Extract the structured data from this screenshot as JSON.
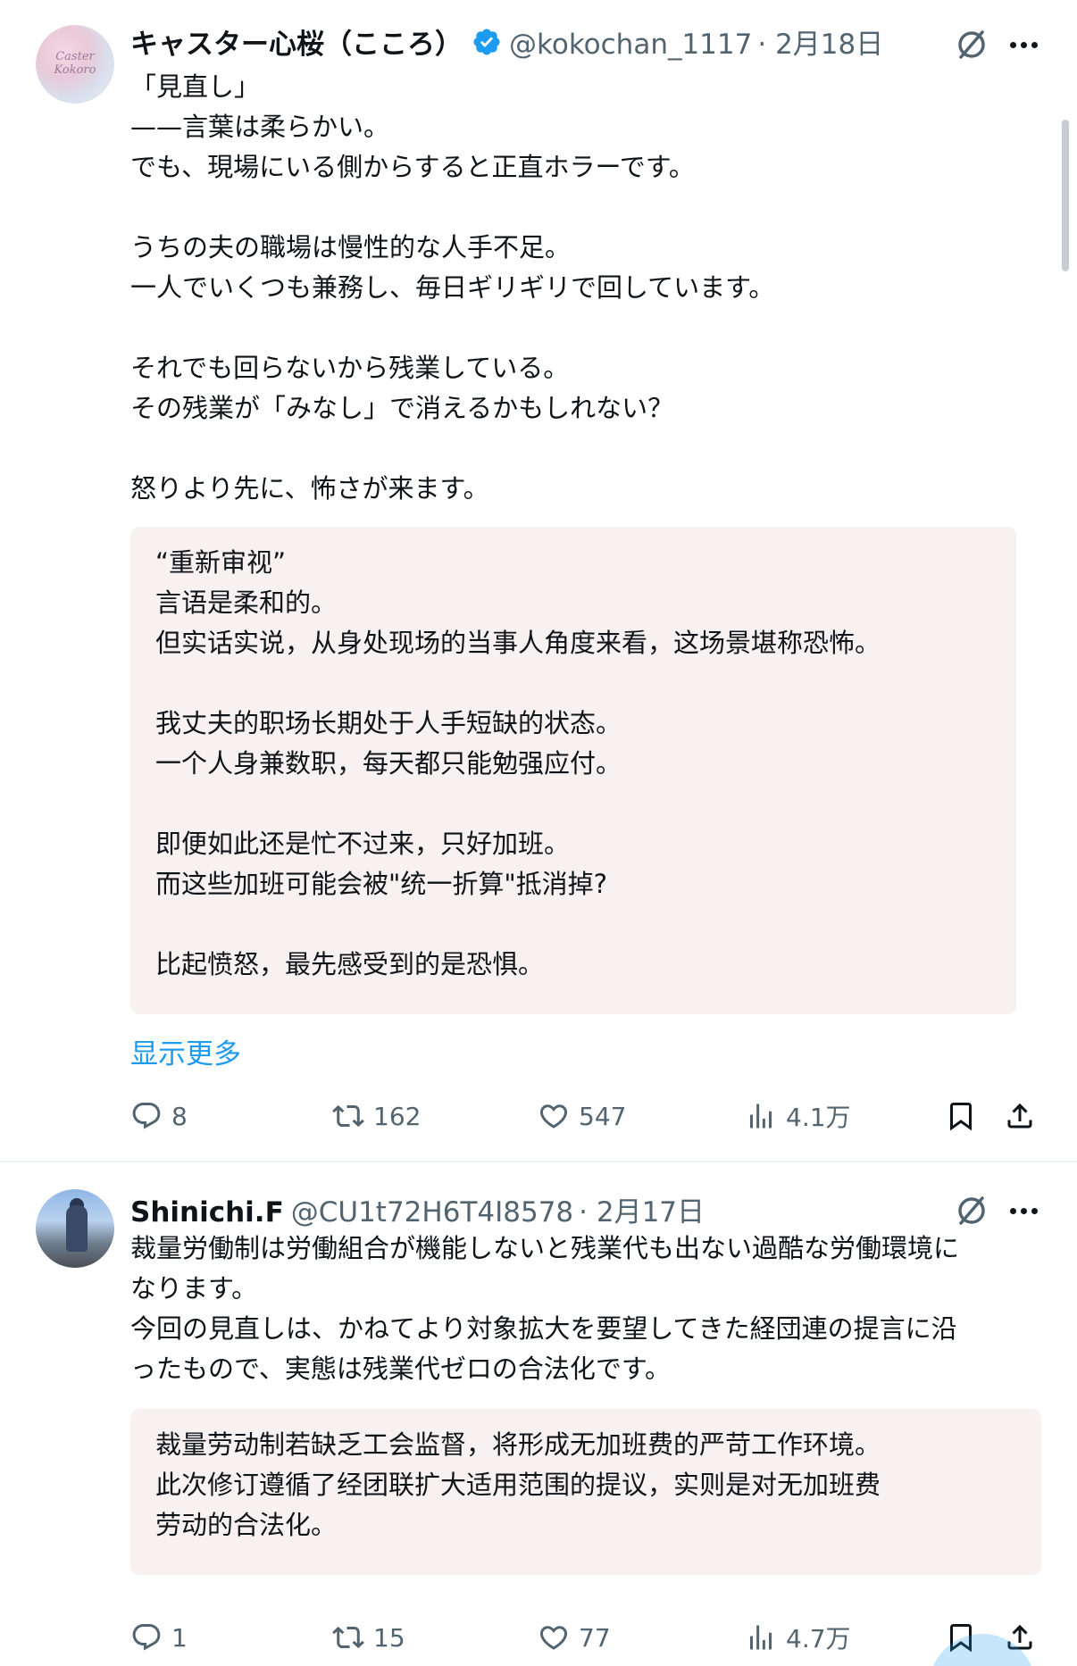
{
  "tweets": [
    {
      "author": {
        "display_name": "キャスター心桜（こころ）",
        "handle": "@kokochan_1117",
        "verified": true,
        "avatar_icon": "avatar-image"
      },
      "date": "· 2月18日",
      "body": [
        "「見直し」",
        "——言葉は柔らかい。",
        "でも、現場にいる側からすると正直ホラーです。",
        "",
        "うちの夫の職場は慢性的な人手不足。",
        "一人でいくつも兼務し、毎日ギリギリで回しています。",
        "",
        "それでも回らないから残業している。",
        "その残業が「みなし」で消えるかもしれない？",
        "",
        "怒りより先に、怖さが来ます。"
      ],
      "translation": [
        "“重新审视”",
        "言语是柔和的。",
        "但实话实说，从身处现场的当事人角度来看，这场景堪称恐怖。",
        "",
        "我丈夫的职场长期处于人手短缺的状态。",
        "一个人身兼数职，每天都只能勉强应付。",
        "",
        "即便如此还是忙不过来，只好加班。",
        "而这些加班可能会被\"统一折算\"抵消掉?",
        "",
        "比起愤怒，最先感受到的是恐惧。"
      ],
      "show_more": "显示更多",
      "stats": {
        "replies": "8",
        "reposts": "162",
        "likes": "547",
        "views": "4.1万"
      }
    },
    {
      "author": {
        "display_name": "Shinichi.F",
        "handle": "@CU1t72H6T4I8578",
        "verified": false,
        "avatar_icon": "avatar-image"
      },
      "date": "· 2月17日",
      "body": [
        "裁量労働制は労働組合が機能しないと残業代も出ない過酷な労働環境に",
        "なります。",
        "今回の見直しは、かねてより対象拡大を要望してきた経団連の提言に沿",
        "ったもので、実態は残業代ゼロの合法化です。"
      ],
      "translation": [
        "裁量劳动制若缺乏工会监督，将形成无加班费的严苛工作环境。",
        "此次修订遵循了经团联扩大适用范围的提议，实则是对无加班费",
        "劳动的合法化。"
      ],
      "stats": {
        "replies": "1",
        "reposts": "15",
        "likes": "77",
        "views": "4.7万"
      }
    }
  ],
  "icons": {
    "verified": "verified-badge-icon",
    "grok": "grok-icon",
    "more": "more-options-icon",
    "reply": "reply-icon",
    "repost": "repost-icon",
    "like": "like-heart-icon",
    "views": "views-chart-icon",
    "bookmark": "bookmark-icon",
    "share": "share-icon"
  },
  "colors": {
    "text": "#0f1419",
    "secondary": "#536471",
    "accent": "#1d9bf0",
    "translation_bg": "#f8f1f1",
    "divider": "#eff3f4"
  }
}
